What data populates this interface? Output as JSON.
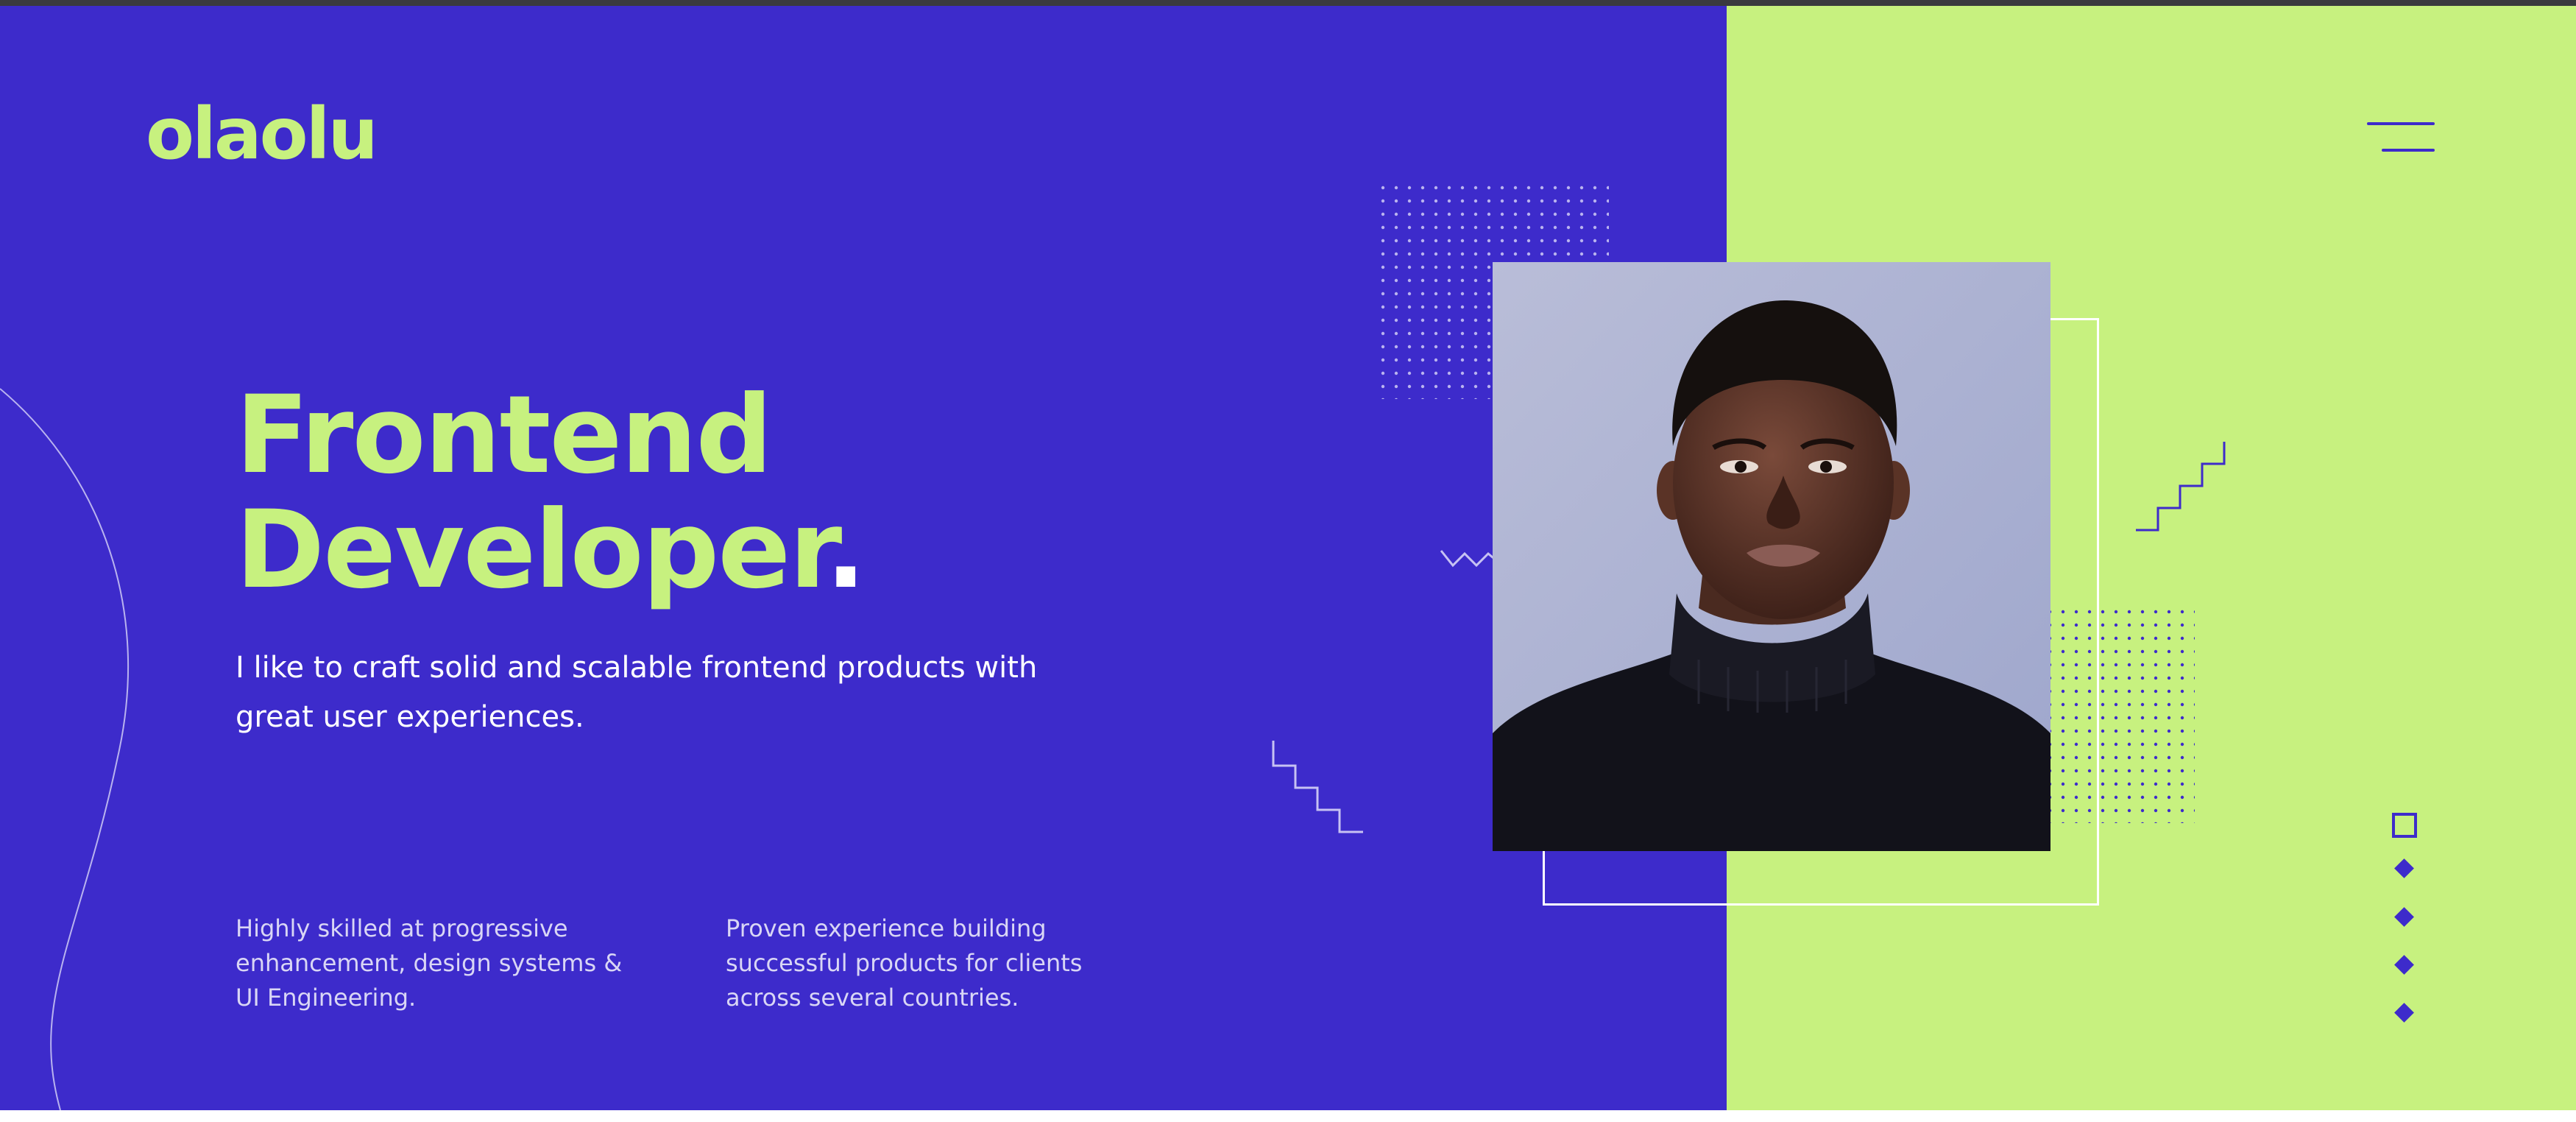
{
  "brand": {
    "logo_text": "olaolu"
  },
  "menu": {
    "icon": "hamburger-menu-icon"
  },
  "hero": {
    "title_line1": "Frontend",
    "title_line2": "Developer",
    "title_dot": ".",
    "subtitle": "I like to craft solid and scalable frontend products with great user experiences."
  },
  "features": [
    {
      "text": "Highly skilled at progressive enhancement, design systems & UI Engineering."
    },
    {
      "text": "Proven experience building successful products for clients across several countries."
    }
  ],
  "portrait": {
    "icon": "developer-portrait-photo"
  },
  "pagination": {
    "icon_active": "square-outline-icon",
    "icon_inactive": "diamond-icon",
    "count": 5,
    "active_index": 0
  },
  "colors": {
    "primary": "#3d2bcb",
    "accent": "#c7f17f",
    "text_light": "#ffffff",
    "text_muted": "#d9d6f5"
  }
}
